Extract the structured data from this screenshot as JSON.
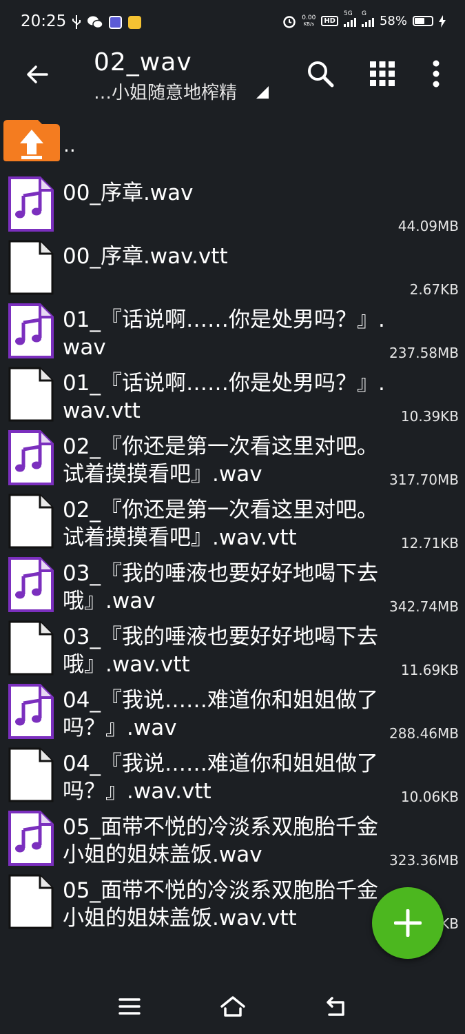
{
  "status_bar": {
    "time": "20:25",
    "net_speed_value": "0.00",
    "net_speed_unit": "KB/s",
    "hd_badge": "HD",
    "net_5g": "5G",
    "net_g": "G",
    "battery": "58%",
    "battery_level": 0.58,
    "left_icons": [
      "usb-icon",
      "wechat-icon",
      "app-icon",
      "mail-icon"
    ],
    "right_icons": [
      "alarm-icon",
      "signal-icon",
      "battery-icon",
      "charging-icon"
    ]
  },
  "toolbar": {
    "title": "02_wav",
    "subtitle": "…小姐随意地榨精",
    "icons": [
      "back-arrow-icon",
      "search-icon",
      "grid-view-icon",
      "more-vert-icon"
    ]
  },
  "parent_dir": {
    "label": ".."
  },
  "files": [
    {
      "name": "00_序章.wav",
      "size": "44.09MB",
      "type": "audio"
    },
    {
      "name": "00_序章.wav.vtt",
      "size": "2.67KB",
      "type": "file"
    },
    {
      "name": "01_『话说啊……你是处男吗？』.wav",
      "size": "237.58MB",
      "type": "audio"
    },
    {
      "name": "01_『话说啊……你是处男吗？』.wav.vtt",
      "size": "10.39KB",
      "type": "file"
    },
    {
      "name": "02_『你还是第一次看这里对吧。试着摸摸看吧』.wav",
      "size": "317.70MB",
      "type": "audio"
    },
    {
      "name": "02_『你还是第一次看这里对吧。试着摸摸看吧』.wav.vtt",
      "size": "12.71KB",
      "type": "file"
    },
    {
      "name": "03_『我的唾液也要好好地喝下去哦』.wav",
      "size": "342.74MB",
      "type": "audio"
    },
    {
      "name": "03_『我的唾液也要好好地喝下去哦』.wav.vtt",
      "size": "11.69KB",
      "type": "file"
    },
    {
      "name": "04_『我说……难道你和姐姐做了吗？』.wav",
      "size": "288.46MB",
      "type": "audio"
    },
    {
      "name": "04_『我说……难道你和姐姐做了吗？』.wav.vtt",
      "size": "10.06KB",
      "type": "file"
    },
    {
      "name": "05_面带不悦的冷淡系双胞胎千金小姐的姐妹盖饭.wav",
      "size": "323.36MB",
      "type": "audio"
    },
    {
      "name": "05_面带不悦的冷淡系双胞胎千金小姐的姐妹盖饭.wav.vtt",
      "size": "KB",
      "type": "file"
    }
  ],
  "fab": {
    "icon": "plus-icon"
  },
  "nav_bar": {
    "icons": [
      "menu-icon",
      "home-icon",
      "back-icon"
    ]
  },
  "colors": {
    "background": "#1c1f23",
    "fab": "#4cb71f",
    "audio_icon": "#7b2fbe",
    "folder": "#f47c20"
  }
}
